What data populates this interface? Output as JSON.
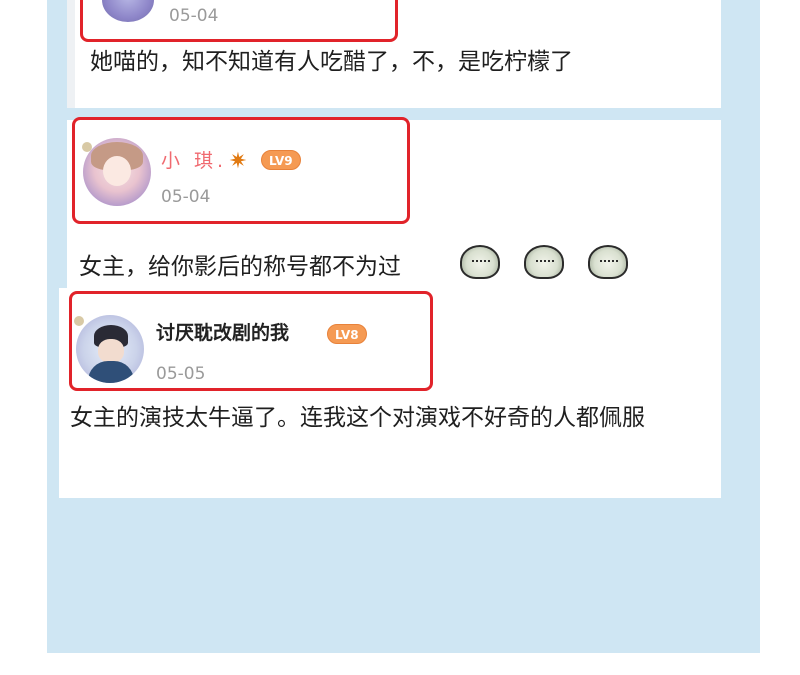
{
  "comments": [
    {
      "username": "",
      "date": "05-04",
      "text": "她喵的，知不知道有人吃醋了，不，是吃柠檬了"
    },
    {
      "username": "小 琪.",
      "username_icon": "spark-icon",
      "level": "LV9",
      "date": "05-04",
      "text": "女主，给你影后的称号都不为过",
      "stickers": [
        "frog-sticker",
        "frog-sticker",
        "frog-sticker"
      ]
    },
    {
      "username": "讨厌耽改剧的我",
      "level": "LV8",
      "date": "05-05",
      "text": "女主的演技太牛逼了。连我这个对演戏不好奇的人都佩服"
    }
  ],
  "colors": {
    "background_panel": "#cfe6f3",
    "highlight_border": "#e1232a",
    "username_pink": "#f06a70",
    "level_badge": "#f59a53",
    "date_gray": "#9a9a9a"
  }
}
